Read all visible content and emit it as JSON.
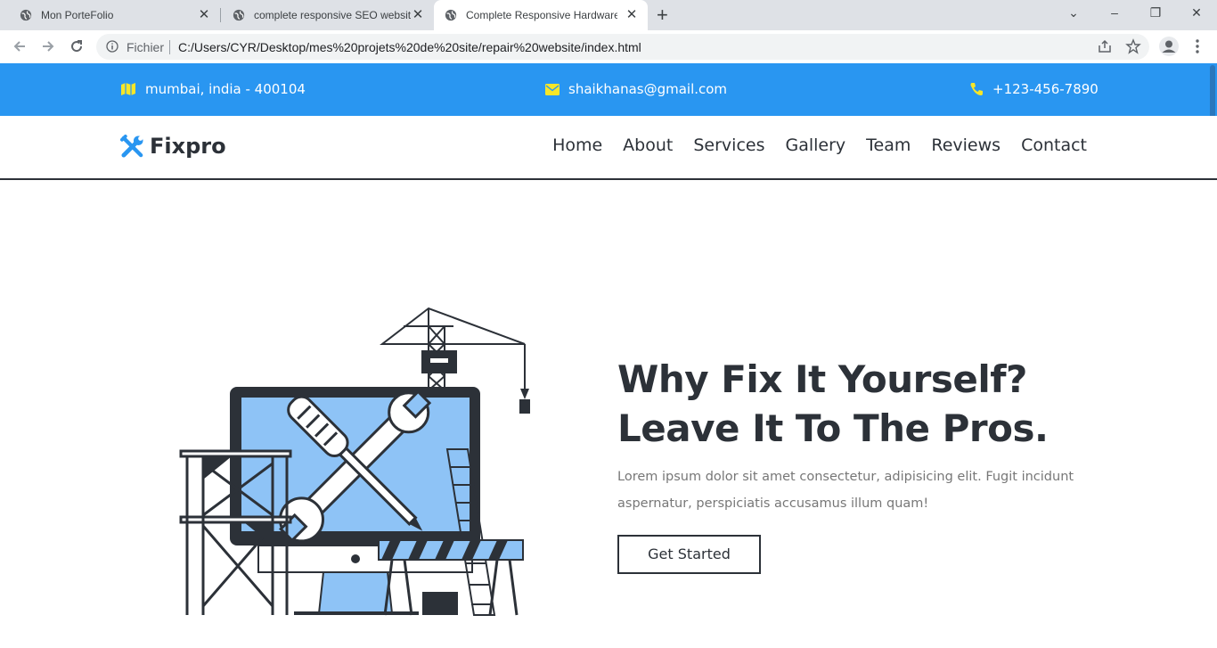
{
  "browser": {
    "tabs": [
      {
        "title": "Mon PorteFolio"
      },
      {
        "title": "complete responsive SEO website"
      },
      {
        "title": "Complete Responsive Hardware Repair"
      }
    ],
    "address": {
      "scheme_label": "Fichier",
      "url": "C:/Users/CYR/Desktop/mes%20projets%20de%20site/repair%20website/index.html"
    }
  },
  "topbar": {
    "address": "mumbai, india - 400104",
    "email": "shaikhanas@gmail.com",
    "phone": "+123-456-7890",
    "accent_color": "#2996f1",
    "icon_color": "#f7e628"
  },
  "header": {
    "logo": "Fixpro",
    "nav": [
      "Home",
      "About",
      "Services",
      "Gallery",
      "Team",
      "Reviews",
      "Contact"
    ]
  },
  "hero": {
    "title_line1": "Why Fix It Yourself?",
    "title_line2": "Leave It To The Pros.",
    "description": "Lorem ipsum dolor sit amet consectetur, adipisicing elit. Fugit incidunt aspernatur, perspiciatis accusamus illum quam!",
    "cta": "Get Started"
  }
}
